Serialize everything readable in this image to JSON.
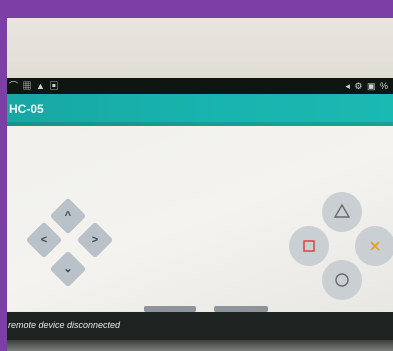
{
  "status_bar": {
    "left_icons": "⌒ ▦ ▲ ▣",
    "right_icons": "◂ ⚙ ▣ %"
  },
  "app_bar": {
    "title": "HC-05"
  },
  "dpad": {
    "up_icon": "chevron-up-icon",
    "down_icon": "chevron-down-icon",
    "left_icon": "chevron-left-icon",
    "right_icon": "chevron-right-icon",
    "up_glyph": "^",
    "down_glyph": "⌄",
    "left_glyph": "<",
    "right_glyph": ">"
  },
  "controller_buttons": {
    "triangle": {
      "icon": "triangle-icon",
      "color": "#6a6a6a"
    },
    "square": {
      "icon": "square-icon",
      "color": "#e04848"
    },
    "cross": {
      "icon": "cross-icon",
      "color": "#e0a020"
    },
    "circle": {
      "icon": "circle-icon",
      "color": "#6a6a6a"
    }
  },
  "snackbar": {
    "message": "remote device disconnected"
  },
  "colors": {
    "accent": "#18b3ae",
    "frame": "#7b3fa6"
  }
}
